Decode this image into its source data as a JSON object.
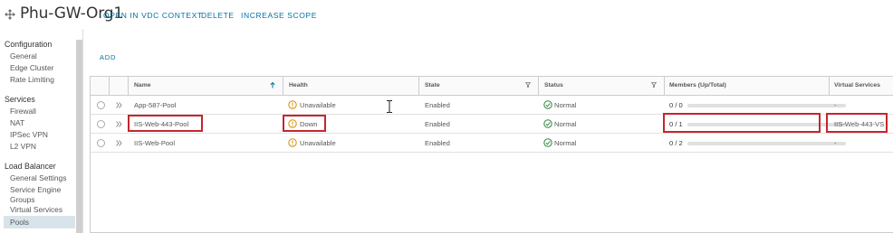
{
  "header": {
    "title": "Phu-GW-Org1",
    "actions": [
      "OPEN IN VDC CONTEXT",
      "DELETE",
      "INCREASE SCOPE"
    ]
  },
  "sidebar": {
    "sections": [
      {
        "heading": "Configuration",
        "items": [
          "General",
          "Edge Cluster",
          "Rate Limiting"
        ]
      },
      {
        "heading": "Services",
        "items": [
          "Firewall",
          "NAT",
          "IPSec VPN",
          "L2 VPN"
        ]
      },
      {
        "heading": "Load Balancer",
        "items": [
          "General Settings",
          "Service Engine Groups",
          "Virtual Services",
          "Pools"
        ]
      }
    ],
    "active_item": "Pools"
  },
  "toolbar": {
    "add_label": "ADD"
  },
  "grid": {
    "columns": [
      "Name",
      "Health",
      "State",
      "Status",
      "Members (Up/Total)",
      "Virtual Services"
    ],
    "rows": [
      {
        "name": "App-587-Pool",
        "health": "Unavailable",
        "state": "Enabled",
        "status": "Normal",
        "members": "0 / 0",
        "members_fraction": 0,
        "virtual_services": "-"
      },
      {
        "name": "IIS-Web-443-Pool",
        "health": "Down",
        "state": "Enabled",
        "status": "Normal",
        "members": "0 / 1",
        "members_fraction": 0,
        "virtual_services": "IIS-Web-443-VS"
      },
      {
        "name": "IIS-Web-Pool",
        "health": "Unavailable",
        "state": "Enabled",
        "status": "Normal",
        "members": "0 / 2",
        "members_fraction": 0,
        "virtual_services": "-"
      }
    ]
  },
  "colors": {
    "link": "#0072a3",
    "health_warning": "#d98b00",
    "status_ok": "#2e8540",
    "highlight": "#c5262c"
  }
}
